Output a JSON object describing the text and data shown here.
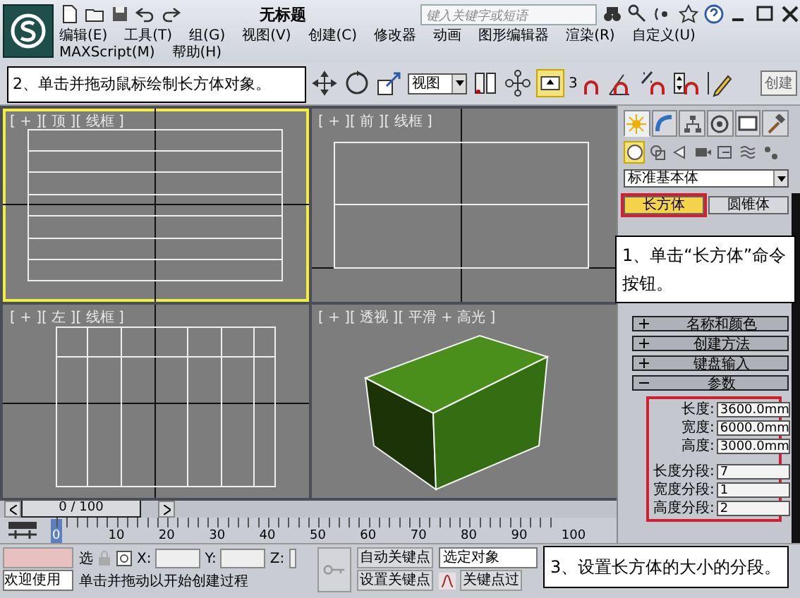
{
  "title_bar": {
    "title": "无标题",
    "search": {
      "placeholder": "键入关键字或短语"
    }
  },
  "menu": [
    "编辑(E)",
    "工具(T)",
    "组(G)",
    "视图(V)",
    "创建(C)",
    "修改器",
    "动画",
    "图形编辑器",
    "渲染(R)",
    "自定义(U)",
    "MAXScript(M)",
    "帮助(H)"
  ],
  "toolbar": {
    "callout": "2、单击并拖动鼠标绘制长方体对象。",
    "view_dropdown": "视图",
    "snap_dimension": "3",
    "selection_set": "创建"
  },
  "viewports": [
    {
      "kind": "top",
      "label": "[ + ][ 顶 ][ 线框 ]",
      "selected": true
    },
    {
      "kind": "front",
      "label": "[ + ][ 前 ][ 线框 ]",
      "selected": false
    },
    {
      "kind": "left",
      "label": "[ + ][ 左 ][ 线框 ]",
      "selected": false
    },
    {
      "kind": "perspective",
      "label": "[ + ][ 透视 ][ 平滑 + 高光 ]",
      "selected": false
    }
  ],
  "command_panel": {
    "tabs": [
      {
        "kind": "create",
        "selected": true
      },
      {
        "kind": "modify",
        "selected": false
      },
      {
        "kind": "hierarchy",
        "selected": false
      },
      {
        "kind": "motion",
        "selected": false
      },
      {
        "kind": "display",
        "selected": false
      },
      {
        "kind": "utilities",
        "selected": false
      }
    ],
    "categories": [
      {
        "kind": "geometry",
        "selected": true
      },
      {
        "kind": "shapes",
        "selected": false
      },
      {
        "kind": "lights",
        "selected": false
      },
      {
        "kind": "cameras",
        "selected": false
      },
      {
        "kind": "helpers",
        "selected": false
      },
      {
        "kind": "spacewarps",
        "selected": false
      },
      {
        "kind": "systems",
        "selected": false
      }
    ],
    "dropdown": "标准基本体",
    "object_buttons": [
      {
        "label": "长方体",
        "selected": true
      },
      {
        "label": "圆锥体",
        "selected": false
      }
    ],
    "callout": "1、单击“长方体”命令按钮。",
    "rollouts": [
      {
        "label": "名称和颜色",
        "expanded": false
      },
      {
        "label": "创建方法",
        "expanded": false
      },
      {
        "label": "键盘输入",
        "expanded": false
      },
      {
        "label": "参数",
        "expanded": true
      }
    ],
    "parameters": [
      {
        "label": "长度:",
        "value": "3600.0mm"
      },
      {
        "label": "宽度:",
        "value": "6000.0mm"
      },
      {
        "label": "高度:",
        "value": "3000.0mm"
      },
      {
        "label": "长度分段:",
        "value": "7"
      },
      {
        "label": "宽度分段:",
        "value": "1"
      },
      {
        "label": "高度分段:",
        "value": "2"
      }
    ]
  },
  "timeline": {
    "frame": "0 / 100",
    "level": 0,
    "ticks": [
      "0",
      "10",
      "20",
      "30",
      "40",
      "50",
      "60",
      "70",
      "80",
      "90",
      "100"
    ]
  },
  "status_bar": {
    "welcome": "欢迎使用",
    "lock_label": "选",
    "x_label": "X:",
    "y_label": "Y:",
    "z_label": "Z:",
    "prompt": "单击并拖动以开始创建过程",
    "auto_key": "自动关键点",
    "set_key": "设置关键点",
    "selection": "选定对象",
    "key_filters": "关键点过",
    "callout": "3、设置长方体的大小的分段。"
  }
}
